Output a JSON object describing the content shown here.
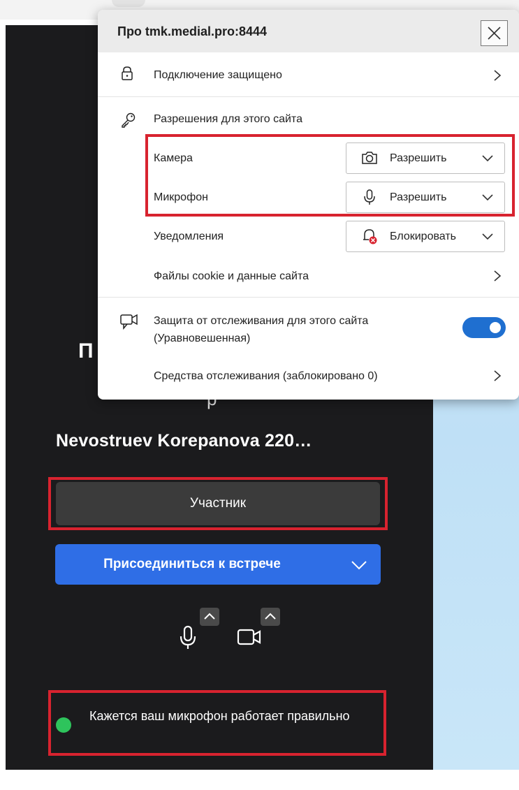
{
  "popup": {
    "title": "Про tmk.medial.pro:8444",
    "connection_label": "Подключение защищено",
    "permissions_header": "Разрешения для этого сайта",
    "permissions": [
      {
        "name": "Камера",
        "value": "Разрешить",
        "icon": "camera-icon"
      },
      {
        "name": "Микрофон",
        "value": "Разрешить",
        "icon": "microphone-icon"
      },
      {
        "name": "Уведомления",
        "value": "Блокировать",
        "icon": "notification-blocked-icon"
      }
    ],
    "cookies_label": "Файлы cookie и данные сайта",
    "tracking_label_line1": "Защита от отслеживания для этого сайта",
    "tracking_label_line2": "(Уравновешенная)",
    "tracking_enabled": true,
    "trackers_label": "Средства отслеживания (заблокировано 0)"
  },
  "meeting": {
    "heading_partial": "П",
    "heading_partial_2": "р",
    "title": "Nevostruev Korepanova 220…",
    "role_button": "Участник",
    "join_button": "Присоединиться к встрече",
    "mic_status": "Кажется ваш микрофон работает правильно"
  },
  "colors": {
    "annotation_red": "#d8232f",
    "join_blue": "#2f6ee6",
    "toggle_blue": "#1f6fd0",
    "status_green": "#2ec45c",
    "dark_panel": "#1b1b1d"
  }
}
